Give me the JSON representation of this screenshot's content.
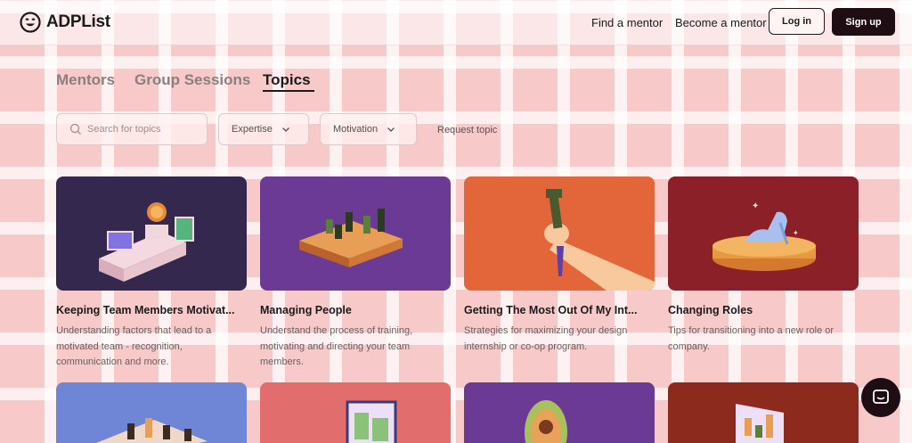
{
  "brand": {
    "name": "ADPList"
  },
  "header": {
    "find_mentor": "Find a mentor",
    "become_mentor": "Become a mentor",
    "login": "Log in",
    "signup": "Sign up"
  },
  "tabs": [
    {
      "label": "Mentors",
      "active": false
    },
    {
      "label": "Group Sessions",
      "active": false
    },
    {
      "label": "Topics",
      "active": true
    }
  ],
  "filters": {
    "search_placeholder": "Search for topics",
    "expertise": "Expertise",
    "motivation": "Motivation",
    "request_topic": "Request topic"
  },
  "topics": [
    {
      "title": "Keeping Team Members Motivat...",
      "description": "Understanding factors that lead to a motivated team - recognition, communication and more.",
      "bg_color": "#35284f",
      "icon": "podium-illustration"
    },
    {
      "title": "Managing People",
      "description": "Understand the process of training, motivating and directing your team members.",
      "bg_color": "#6a3a94",
      "icon": "chessboard-illustration"
    },
    {
      "title": "Getting The Most Out Of My Int...",
      "description": "Strategies for maximizing your design internship or co-op program.",
      "bg_color": "#e2663a",
      "icon": "raised-hand-illustration"
    },
    {
      "title": "Changing Roles",
      "description": "Tips for transitioning into a new role or company.",
      "bg_color": "#8c2028",
      "icon": "glass-slipper-illustration"
    }
  ],
  "more_topics": [
    {
      "bg_color": "#6f86d6",
      "icon": "chess-pieces-illustration"
    },
    {
      "bg_color": "#e26d6d",
      "icon": "picture-frame-illustration"
    },
    {
      "bg_color": "#6a3a94",
      "icon": "mirror-illustration"
    },
    {
      "bg_color": "#8c2b1d",
      "icon": "chart-board-illustration"
    }
  ],
  "chat": {
    "icon": "chat-icon"
  }
}
